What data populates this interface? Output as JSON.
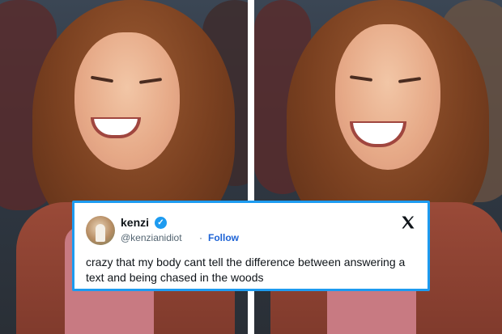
{
  "tweet": {
    "display_name": "kenzi",
    "handle": "@kenzianidiot",
    "separator": "·",
    "follow_label": "Follow",
    "verified_glyph": "✓",
    "text": "crazy that my body cant tell the difference between answering a text and being chased in the woods",
    "icons": {
      "verified": "verified-badge-icon",
      "platform": "x-logo-icon"
    },
    "colors": {
      "accent": "#1d9bf0",
      "follow_link": "#1d63d6",
      "text": "#0f1419",
      "secondary": "#536471"
    }
  }
}
